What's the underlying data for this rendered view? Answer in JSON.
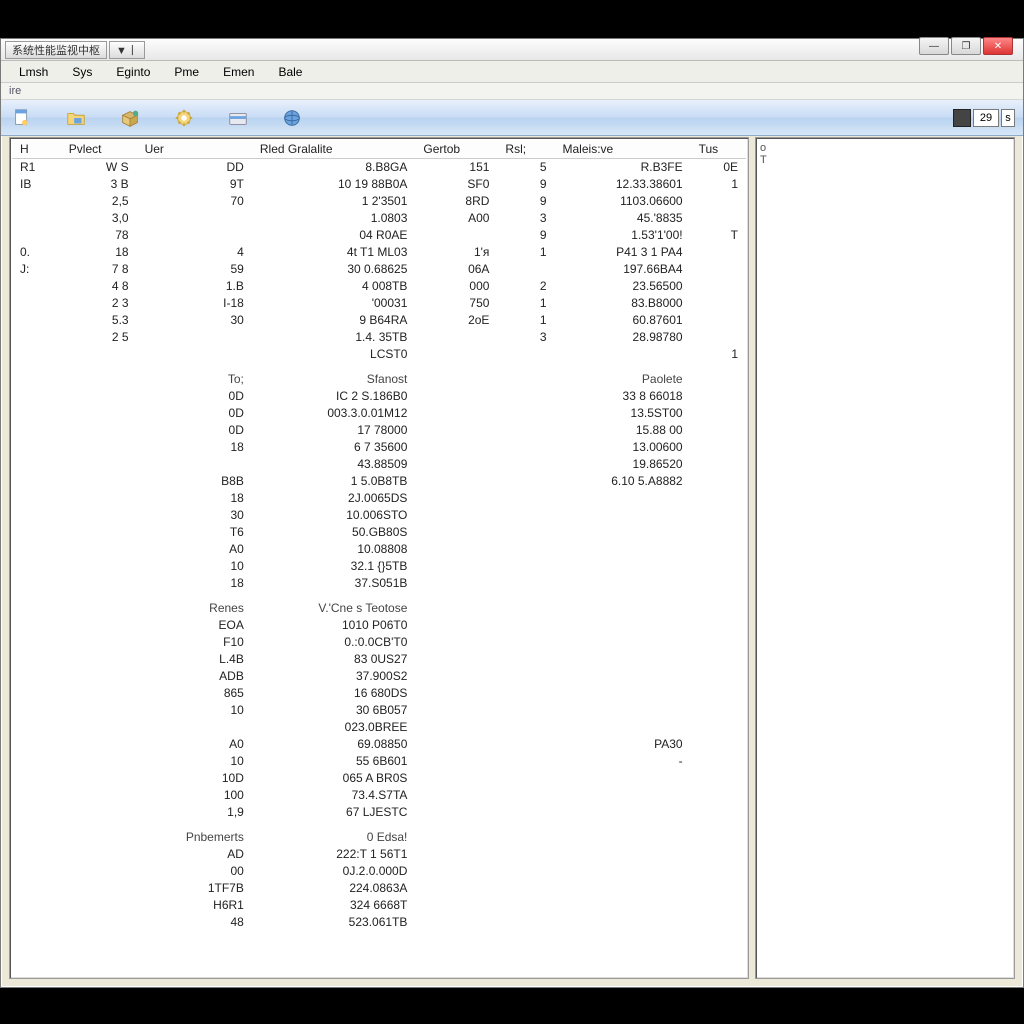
{
  "titlebar": {
    "app_title": "系统性能监视中枢",
    "dropdown": "▼丨"
  },
  "win_controls": {
    "min": "—",
    "max": "❐",
    "close": "✕"
  },
  "menubar": {
    "items": [
      "Lmsh",
      "Sys",
      "Eginto",
      "Pme",
      "Emen",
      "Bale"
    ]
  },
  "sub_label": "ire",
  "zoom": {
    "value": "29",
    "pct": "s"
  },
  "side_pane": {
    "lines": [
      "o",
      "",
      "",
      "",
      "T"
    ]
  },
  "columns": [
    "H",
    "Pvlect",
    "Uer",
    "Rled Gralalite",
    "Gertob",
    "Rsl;",
    "Maleis:ve",
    "Tus"
  ],
  "rows_main": [
    [
      "R1",
      "W S",
      "DD",
      "8.B8GA",
      "151",
      "5",
      "R.B3FE",
      "0E"
    ],
    [
      "IB",
      "3 B",
      "9T",
      "10 19 88B0A",
      "SF0",
      "9",
      "12.33.38601",
      "1"
    ],
    [
      "",
      "2,5",
      "70",
      "1 2'3501",
      "8RD",
      "9",
      "1103.06600",
      ""
    ],
    [
      "",
      "3,0",
      "",
      "1.0803",
      "A00",
      "3",
      "45.'8835",
      ""
    ],
    [
      "",
      "78",
      "",
      "04 R0AE",
      "",
      "9",
      "1.53'1'00!",
      "T"
    ],
    [
      "0.",
      "18",
      "4",
      "4t T1 ML03",
      "1'я",
      "1",
      "P41 3 1 PA4",
      ""
    ],
    [
      "J:",
      "7 8",
      "59",
      "30 0.68625",
      "06A",
      "",
      "197.66BA4",
      ""
    ],
    [
      "",
      "4 8",
      "1.B",
      "4 008TB",
      "000",
      "2",
      "23.56500",
      ""
    ],
    [
      "",
      "2 3",
      "I-18",
      "'00031",
      "750",
      "1",
      "83.B8000",
      ""
    ],
    [
      "",
      "5.3",
      "30",
      "9 B64RA",
      "2oE",
      "1",
      "60.87601",
      ""
    ],
    [
      "",
      "2 5",
      "",
      "1.4. 35TB",
      "",
      "3",
      "28.98780",
      ""
    ],
    [
      "",
      "",
      "",
      "LCST0",
      "",
      "",
      "",
      "1"
    ]
  ],
  "section2": {
    "headers": [
      "To;",
      "Sfanost",
      "",
      "",
      "",
      "Paolete"
    ],
    "rows": [
      [
        "0D",
        "IC 2 S.186B0",
        "",
        "",
        "",
        "33 8 66018"
      ],
      [
        "0D",
        "003.3.0.01M12",
        "",
        "",
        "",
        "13.5ST00"
      ],
      [
        "0D",
        "17 78000",
        "",
        "",
        "",
        "15.88 00"
      ],
      [
        "18",
        "6 7 35600",
        "",
        "",
        "",
        "13.00600"
      ],
      [
        "",
        "43.88509",
        "",
        "",
        "",
        "19.86520"
      ],
      [
        "B8B",
        "1 5.0B8TB",
        "",
        "",
        "",
        "6.10 5.A8882"
      ],
      [
        "18",
        "2J.0065DS",
        "",
        "",
        "",
        ""
      ],
      [
        "30",
        "10.006STO",
        "",
        "",
        "",
        ""
      ],
      [
        "T6",
        "50.GB80S",
        "",
        "",
        "",
        ""
      ],
      [
        "A0",
        "10.08808",
        "",
        "",
        "",
        ""
      ],
      [
        "10",
        "32.1 {}5TB",
        "",
        "",
        "",
        ""
      ],
      [
        "18",
        "37.S051B",
        "",
        "",
        "",
        ""
      ]
    ]
  },
  "section3": {
    "headers": [
      "Renes",
      "V.'Cne s  Teotose",
      "",
      "",
      "",
      ""
    ],
    "rows": [
      [
        "EOA",
        "1010 P06T0",
        "",
        "",
        "",
        ""
      ],
      [
        "F10",
        "0.:0.0CB'T0",
        "",
        "",
        "",
        ""
      ],
      [
        "L.4B",
        "83 0US27",
        "",
        "",
        "",
        ""
      ],
      [
        "ADB",
        "37.900S2",
        "",
        "",
        "",
        ""
      ],
      [
        "865",
        "16 680DS",
        "",
        "",
        "",
        ""
      ],
      [
        "10",
        "30 6B057",
        "",
        "",
        "",
        ""
      ],
      [
        "",
        "023.0BREE",
        "",
        "",
        "",
        ""
      ],
      [
        "A0",
        "69.08850",
        "",
        "",
        "",
        "PA30"
      ],
      [
        "10",
        "55 6B601",
        "",
        "",
        "",
        "-"
      ],
      [
        "10D",
        "065 A BR0S",
        "",
        "",
        "",
        ""
      ],
      [
        "100",
        "73.4.S7TA",
        "",
        "",
        "",
        ""
      ],
      [
        "1,9",
        "67 LJESTC",
        "",
        "",
        "",
        ""
      ]
    ]
  },
  "section4": {
    "headers": [
      "Pnbemerts",
      "0 Edsa!",
      "",
      "",
      "",
      ""
    ],
    "rows": [
      [
        "AD",
        "222:T 1 56T1",
        "",
        "",
        "",
        ""
      ],
      [
        "00",
        "0J.2.0.000D",
        "",
        "",
        "",
        ""
      ],
      [
        "1TF7B",
        "224.0863A",
        "",
        "",
        "",
        ""
      ],
      [
        "H6R1",
        "324 6668T",
        "",
        "",
        "",
        ""
      ],
      [
        "48",
        "523.061TB",
        "",
        "",
        "",
        ""
      ]
    ]
  }
}
